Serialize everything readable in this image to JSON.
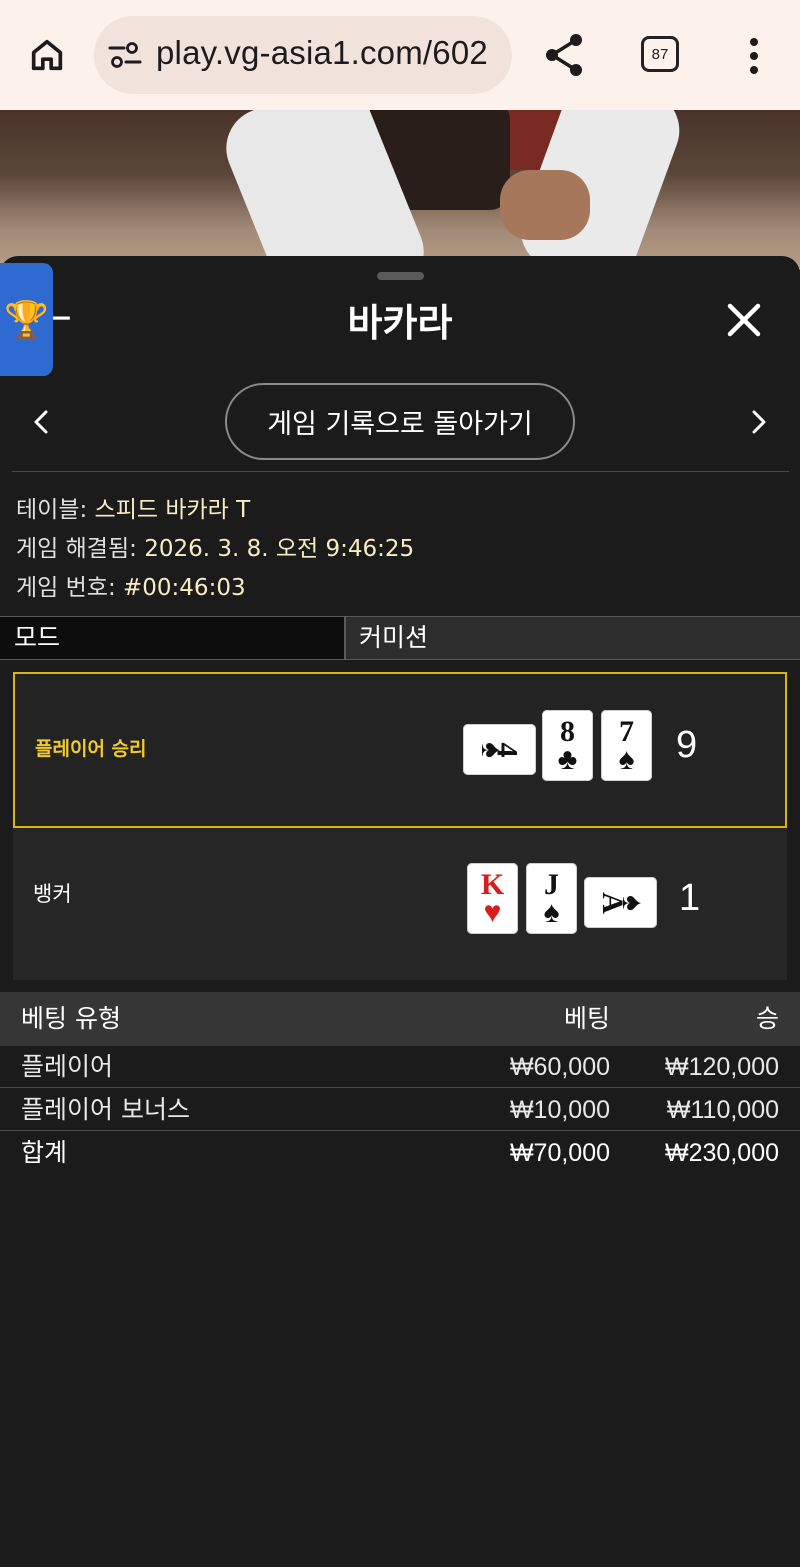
{
  "browser": {
    "url": "play.vg-asia1.com/602",
    "tab_count": "87"
  },
  "header": {
    "title": "바카라",
    "history_button": "게임 기록으로 돌아가기"
  },
  "game_info": {
    "table_label": "테이블:",
    "table_value": "스피드 바카라 T",
    "resolved_label": "게임 해결됨:",
    "resolved_value": "2026. 3. 8. 오전 9:46:25",
    "number_label": "게임 번호:",
    "number_value": "#00:46:03"
  },
  "mode": {
    "label": "모드",
    "value": "커미션"
  },
  "results": {
    "player": {
      "label": "플레이어 승리",
      "score": "9",
      "cards": [
        {
          "rank": "4",
          "suit": "♠",
          "color": "black",
          "orientation": "horizontal"
        },
        {
          "rank": "8",
          "suit": "♣",
          "color": "black",
          "orientation": "vertical"
        },
        {
          "rank": "7",
          "suit": "♠",
          "color": "black",
          "orientation": "vertical"
        }
      ]
    },
    "banker": {
      "label": "뱅커",
      "score": "1",
      "cards": [
        {
          "rank": "K",
          "suit": "♥",
          "color": "red",
          "orientation": "vertical"
        },
        {
          "rank": "J",
          "suit": "♠",
          "color": "black",
          "orientation": "vertical"
        },
        {
          "rank": "A",
          "suit": "♠",
          "color": "black",
          "orientation": "horizontal"
        }
      ]
    }
  },
  "bets": {
    "headers": {
      "type": "베팅 유형",
      "bet": "베팅",
      "win": "승"
    },
    "rows": [
      {
        "type": "플레이어",
        "bet": "₩60,000",
        "win": "₩120,000"
      },
      {
        "type": "플레이어 보너스",
        "bet": "₩10,000",
        "win": "₩110,000"
      }
    ],
    "total": {
      "type": "합계",
      "bet": "₩70,000",
      "win": "₩230,000"
    }
  },
  "colors": {
    "accent_yellow": "#d9b514",
    "trophy_tab": "#2f6ad1",
    "info_value": "#f7edc4"
  },
  "icons": {
    "home": "home-icon",
    "url_settings": "page-info-icon",
    "share": "share-icon",
    "menu": "more-vert-icon",
    "trophy": "trophy-icon",
    "back": "arrow-left-icon",
    "close": "close-icon",
    "prev": "chevron-left-icon",
    "next": "chevron-right-icon"
  }
}
